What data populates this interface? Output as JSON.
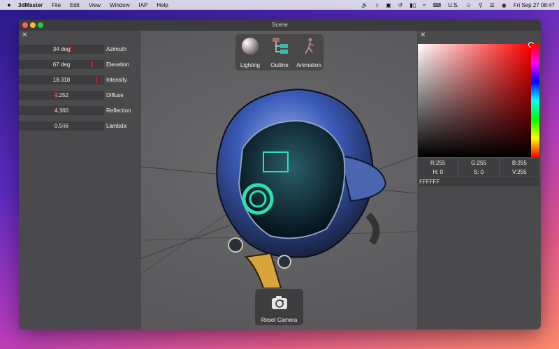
{
  "menubar": {
    "apple": "",
    "items": [
      "3dMaster",
      "File",
      "Edit",
      "View",
      "Window",
      "IAP",
      "Help"
    ],
    "status_icons": [
      "volume-icon",
      "bluetooth-icon",
      "display-icon",
      "time-machine-icon",
      "battery-icon",
      "wifi-icon",
      "keyboard-icon"
    ],
    "input_source": "U.S.",
    "datetime": "Fri Sep 27  08:47"
  },
  "window": {
    "title": "Scene"
  },
  "left_panel": {
    "params": [
      {
        "value": "34 deg",
        "label": "Azimuth",
        "marker": 0.6
      },
      {
        "value": "67 deg",
        "label": "Elevation",
        "marker": 0.85
      },
      {
        "value": "18.318",
        "label": "Intensity",
        "marker": 0.9
      },
      {
        "value": "4.252",
        "label": "Diffuse",
        "marker": 0.43
      },
      {
        "value": "4.860",
        "label": "Reflection",
        "marker": 0.47
      },
      {
        "value": "0.566",
        "label": "Lambda",
        "marker": 0.52
      }
    ]
  },
  "toolbar": {
    "lighting_label": "Lighting",
    "outline_label": "Outline",
    "animation_label": "Animation"
  },
  "reset_button": {
    "label": "Reset Camera"
  },
  "color_picker": {
    "r": "R:255",
    "g": "G:255",
    "b": "B:255",
    "h": "H:  0",
    "s": "S:  0",
    "v": "V:255",
    "hex": "FFFFFF",
    "accent": "#ff0000"
  }
}
